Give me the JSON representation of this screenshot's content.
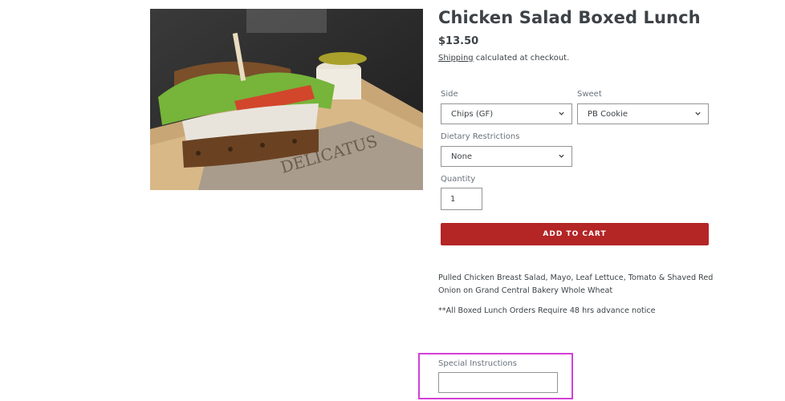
{
  "product": {
    "title": "Chicken Salad Boxed Lunch",
    "price": "$13.50",
    "shipping_link": "Shipping",
    "shipping_rest": " calculated at checkout.",
    "image_watermark": "DELICATUS"
  },
  "options": {
    "side": {
      "label": "Side",
      "value": "Chips (GF)"
    },
    "sweet": {
      "label": "Sweet",
      "value": "PB Cookie"
    },
    "dietary": {
      "label": "Dietary Restrictions",
      "value": "None"
    },
    "quantity": {
      "label": "Quantity",
      "value": "1"
    }
  },
  "cart": {
    "add_label": "ADD TO CART",
    "button_color": "#b42526"
  },
  "description": {
    "text": "Pulled Chicken Breast Salad, Mayo, Leaf Lettuce, Tomato & Shaved Red Onion on Grand Central Bakery Whole Wheat",
    "notice": "**All Boxed Lunch Orders Require 48 hrs advance notice"
  },
  "special_instructions": {
    "label": "Special Instructions",
    "value": "",
    "highlight_color": "#d23fd6"
  },
  "icons": {
    "select_arrow": "chevron-down-icon"
  }
}
